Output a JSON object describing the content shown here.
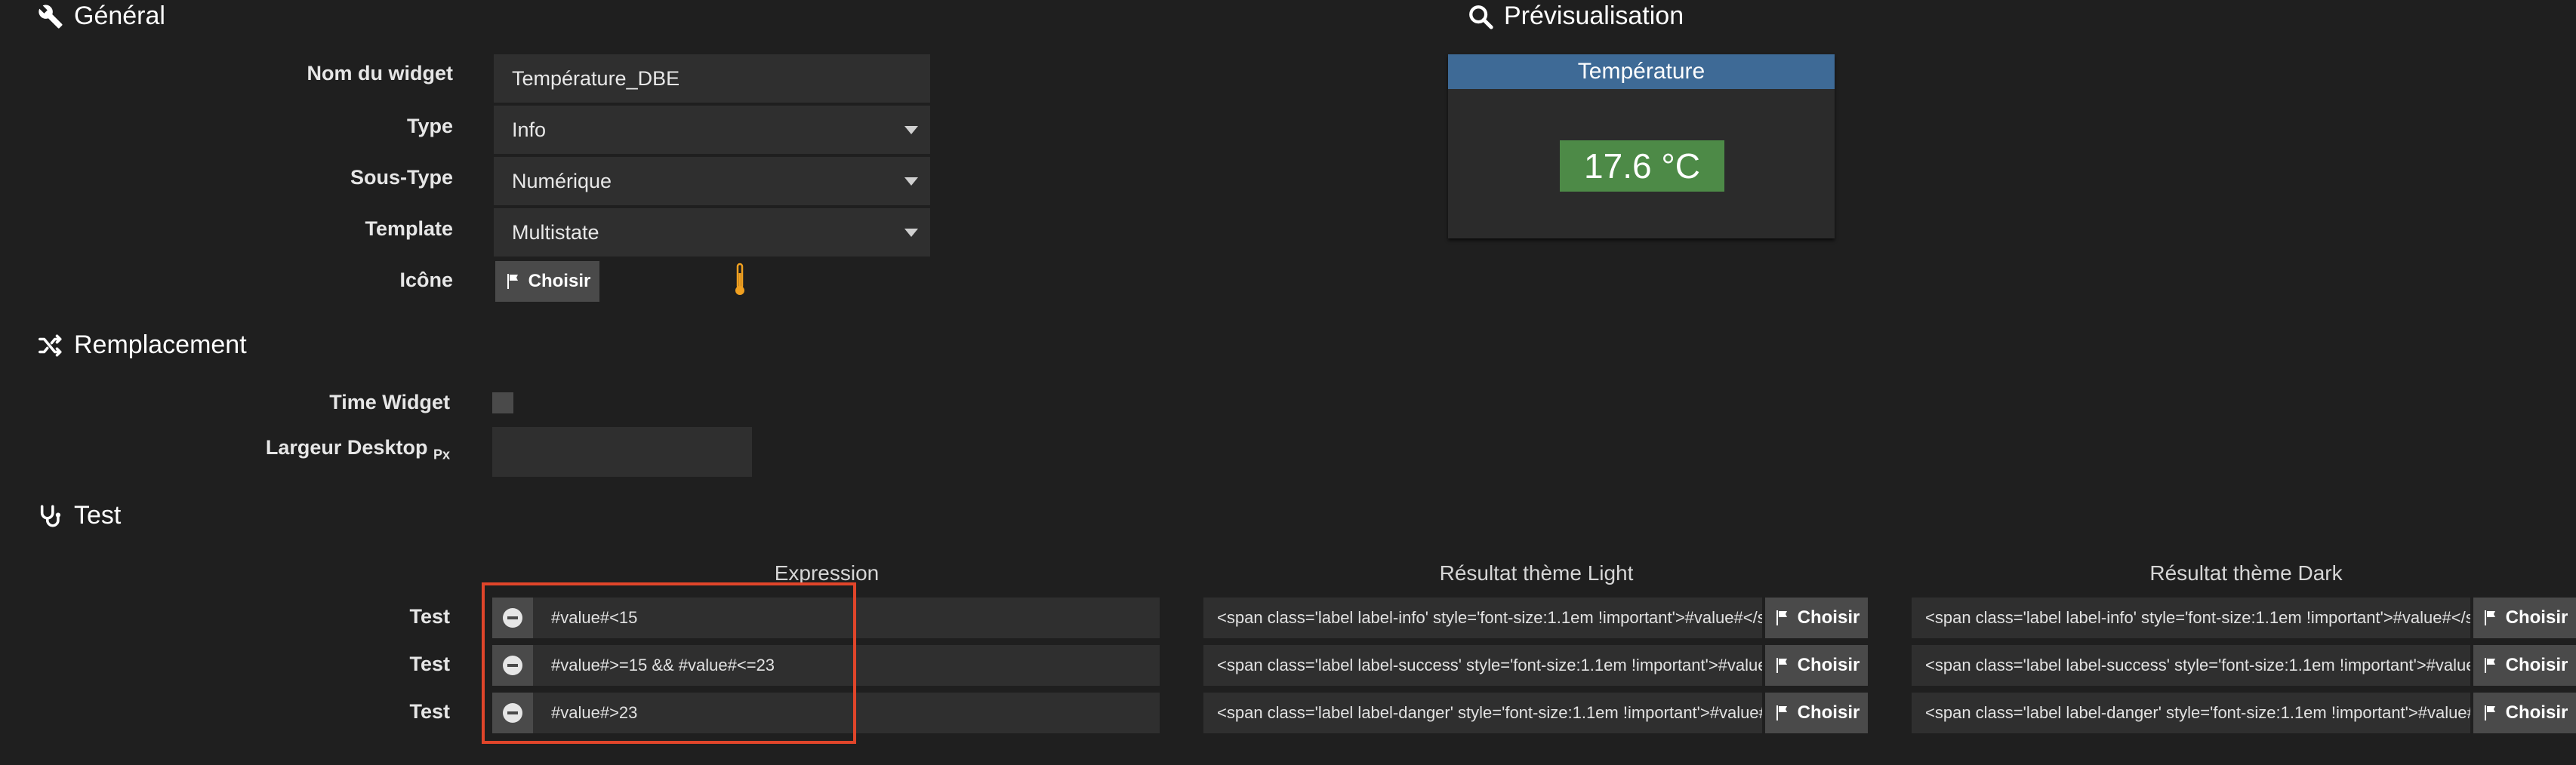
{
  "general": {
    "title": "Général",
    "fields": {
      "name_label": "Nom du widget",
      "name_value": "Température_DBE",
      "type_label": "Type",
      "type_value": "Info",
      "subtype_label": "Sous-Type",
      "subtype_value": "Numérique",
      "template_label": "Template",
      "template_value": "Multistate",
      "icon_label": "Icône",
      "icon_button": "Choisir"
    }
  },
  "preview": {
    "title": "Prévisualisation",
    "widget_title": "Température",
    "widget_value": "17.6 °C"
  },
  "replacement": {
    "title": "Remplacement",
    "time_widget_label": "Time Widget",
    "width_label": "Largeur Desktop",
    "width_unit": "Px",
    "width_value": ""
  },
  "test": {
    "title": "Test",
    "col_expression": "Expression",
    "col_light": "Résultat thème Light",
    "col_dark": "Résultat thème Dark",
    "choose_label": "Choisir",
    "rows": [
      {
        "label": "Test",
        "expression": "#value#<15",
        "light": "<span class='label label-info' style='font-size:1.1em !important'>#value#</span>",
        "dark": "<span class='label label-info' style='font-size:1.1em !important'>#value#</span>"
      },
      {
        "label": "Test",
        "expression": "#value#>=15 && #value#<=23",
        "light": "<span class='label label-success' style='font-size:1.1em !important'>#value#</span>",
        "dark": "<span class='label label-success' style='font-size:1.1em !important'>#value#</span>"
      },
      {
        "label": "Test",
        "expression": "#value#>23",
        "light": "<span class='label label-danger' style='font-size:1.1em !important'>#value#</span>",
        "dark": "<span class='label label-danger' style='font-size:1.1em !important'>#value#</span>"
      }
    ]
  },
  "colors": {
    "background": "#1f1f1f",
    "field": "#2f2f2f",
    "widget_header": "#3e6a96",
    "value_badge": "#4d8a47",
    "highlight": "#e0452a",
    "thermometer": "#f0a020"
  }
}
